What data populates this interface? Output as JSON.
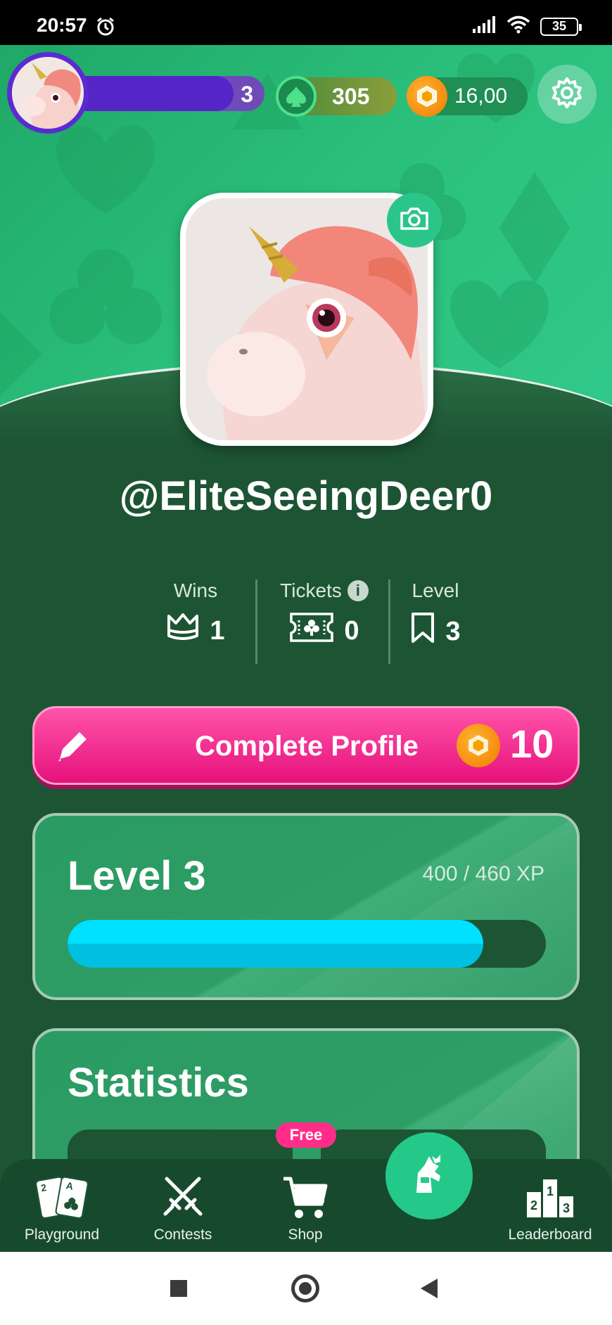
{
  "status_bar": {
    "time": "20:57",
    "battery": "35"
  },
  "hud": {
    "player_level": "3",
    "level_progress": 0.84,
    "spades": "305",
    "coins": "16,00",
    "colors": {
      "purple": "#5b2bd2",
      "spade_green": "#4fe08b",
      "coin_orange": "#f07a00"
    }
  },
  "profile": {
    "username": "@EliteSeeingDeer0"
  },
  "stats": {
    "wins_label": "Wins",
    "wins_value": "1",
    "tickets_label": "Tickets",
    "tickets_value": "0",
    "level_label": "Level",
    "level_value": "3"
  },
  "complete_profile": {
    "label": "Complete Profile",
    "reward": "10",
    "color": "#e6127c"
  },
  "level_card": {
    "title": "Level 3",
    "xp_text": "400 / 460 XP",
    "progress": 0.8696,
    "bar_color": "#00e0ff"
  },
  "statistics_card": {
    "title": "Statistics"
  },
  "bottom_nav": {
    "items": [
      {
        "label": "Playground",
        "icon": "playing-cards-icon"
      },
      {
        "label": "Contests",
        "icon": "crossed-swords-icon"
      },
      {
        "label": "Shop",
        "icon": "cart-icon",
        "badge": "Free"
      },
      {
        "label": "",
        "icon": "knight-icon"
      },
      {
        "label": "Leaderboard",
        "icon": "podium-icon"
      }
    ]
  }
}
